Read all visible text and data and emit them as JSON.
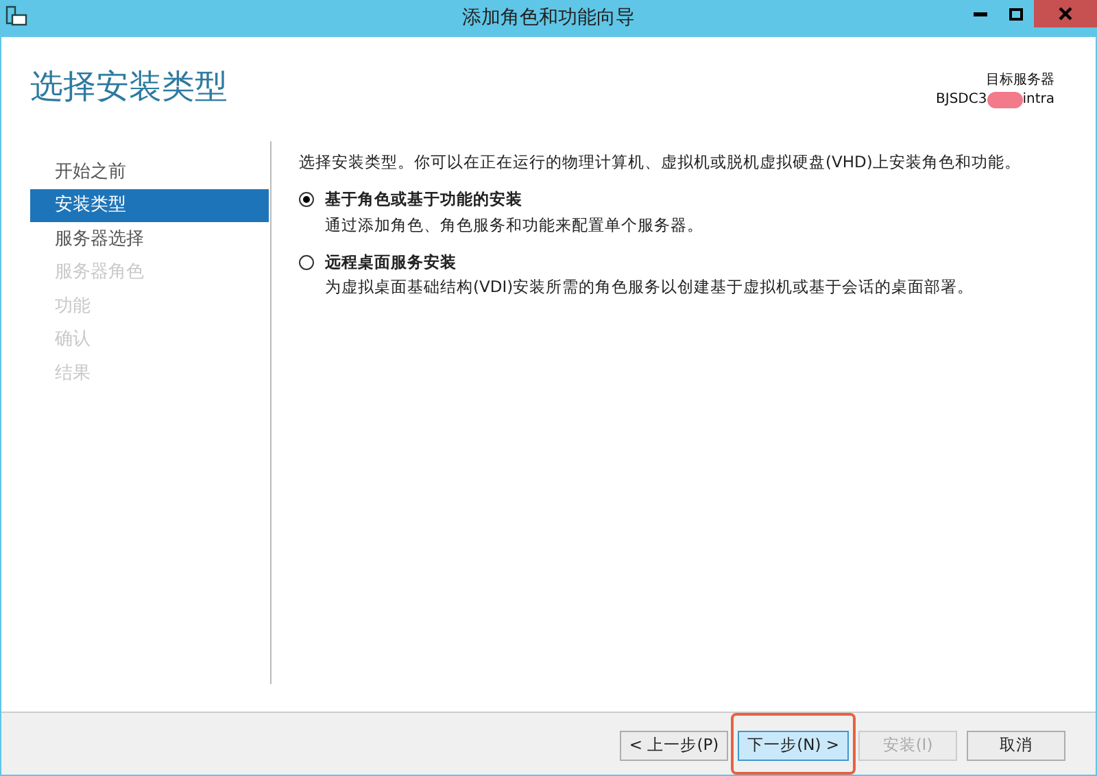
{
  "window": {
    "title": "添加角色和功能向导"
  },
  "page_title": "选择安装类型",
  "target_server": {
    "label": "目标服务器",
    "name_start": "BJSDC3",
    "name_end": "intra"
  },
  "steps": [
    {
      "label": "开始之前",
      "selected": false,
      "disabled": false
    },
    {
      "label": "安装类型",
      "selected": true,
      "disabled": false
    },
    {
      "label": "服务器选择",
      "selected": false,
      "disabled": false
    },
    {
      "label": "服务器角色",
      "selected": false,
      "disabled": true
    },
    {
      "label": "功能",
      "selected": false,
      "disabled": true
    },
    {
      "label": "确认",
      "selected": false,
      "disabled": true
    },
    {
      "label": "结果",
      "selected": false,
      "disabled": true
    }
  ],
  "intro": "选择安装类型。你可以在正在运行的物理计算机、虚拟机或脱机虚拟硬盘(VHD)上安装角色和功能。",
  "options": [
    {
      "label": "基于角色或基于功能的安装",
      "description": "通过添加角色、角色服务和功能来配置单个服务器。",
      "selected": true
    },
    {
      "label": "远程桌面服务安装",
      "description": "为虚拟桌面基础结构(VDI)安装所需的角色服务以创建基于虚拟机或基于会话的桌面部署。",
      "selected": false
    }
  ],
  "buttons": [
    {
      "label": "< 上一步(P)",
      "disabled": false,
      "highlighted": false
    },
    {
      "label": "下一步(N) >",
      "disabled": false,
      "highlighted": true
    },
    {
      "label": "安装(I)",
      "disabled": true,
      "highlighted": false
    },
    {
      "label": "取消",
      "disabled": false,
      "highlighted": false
    }
  ]
}
